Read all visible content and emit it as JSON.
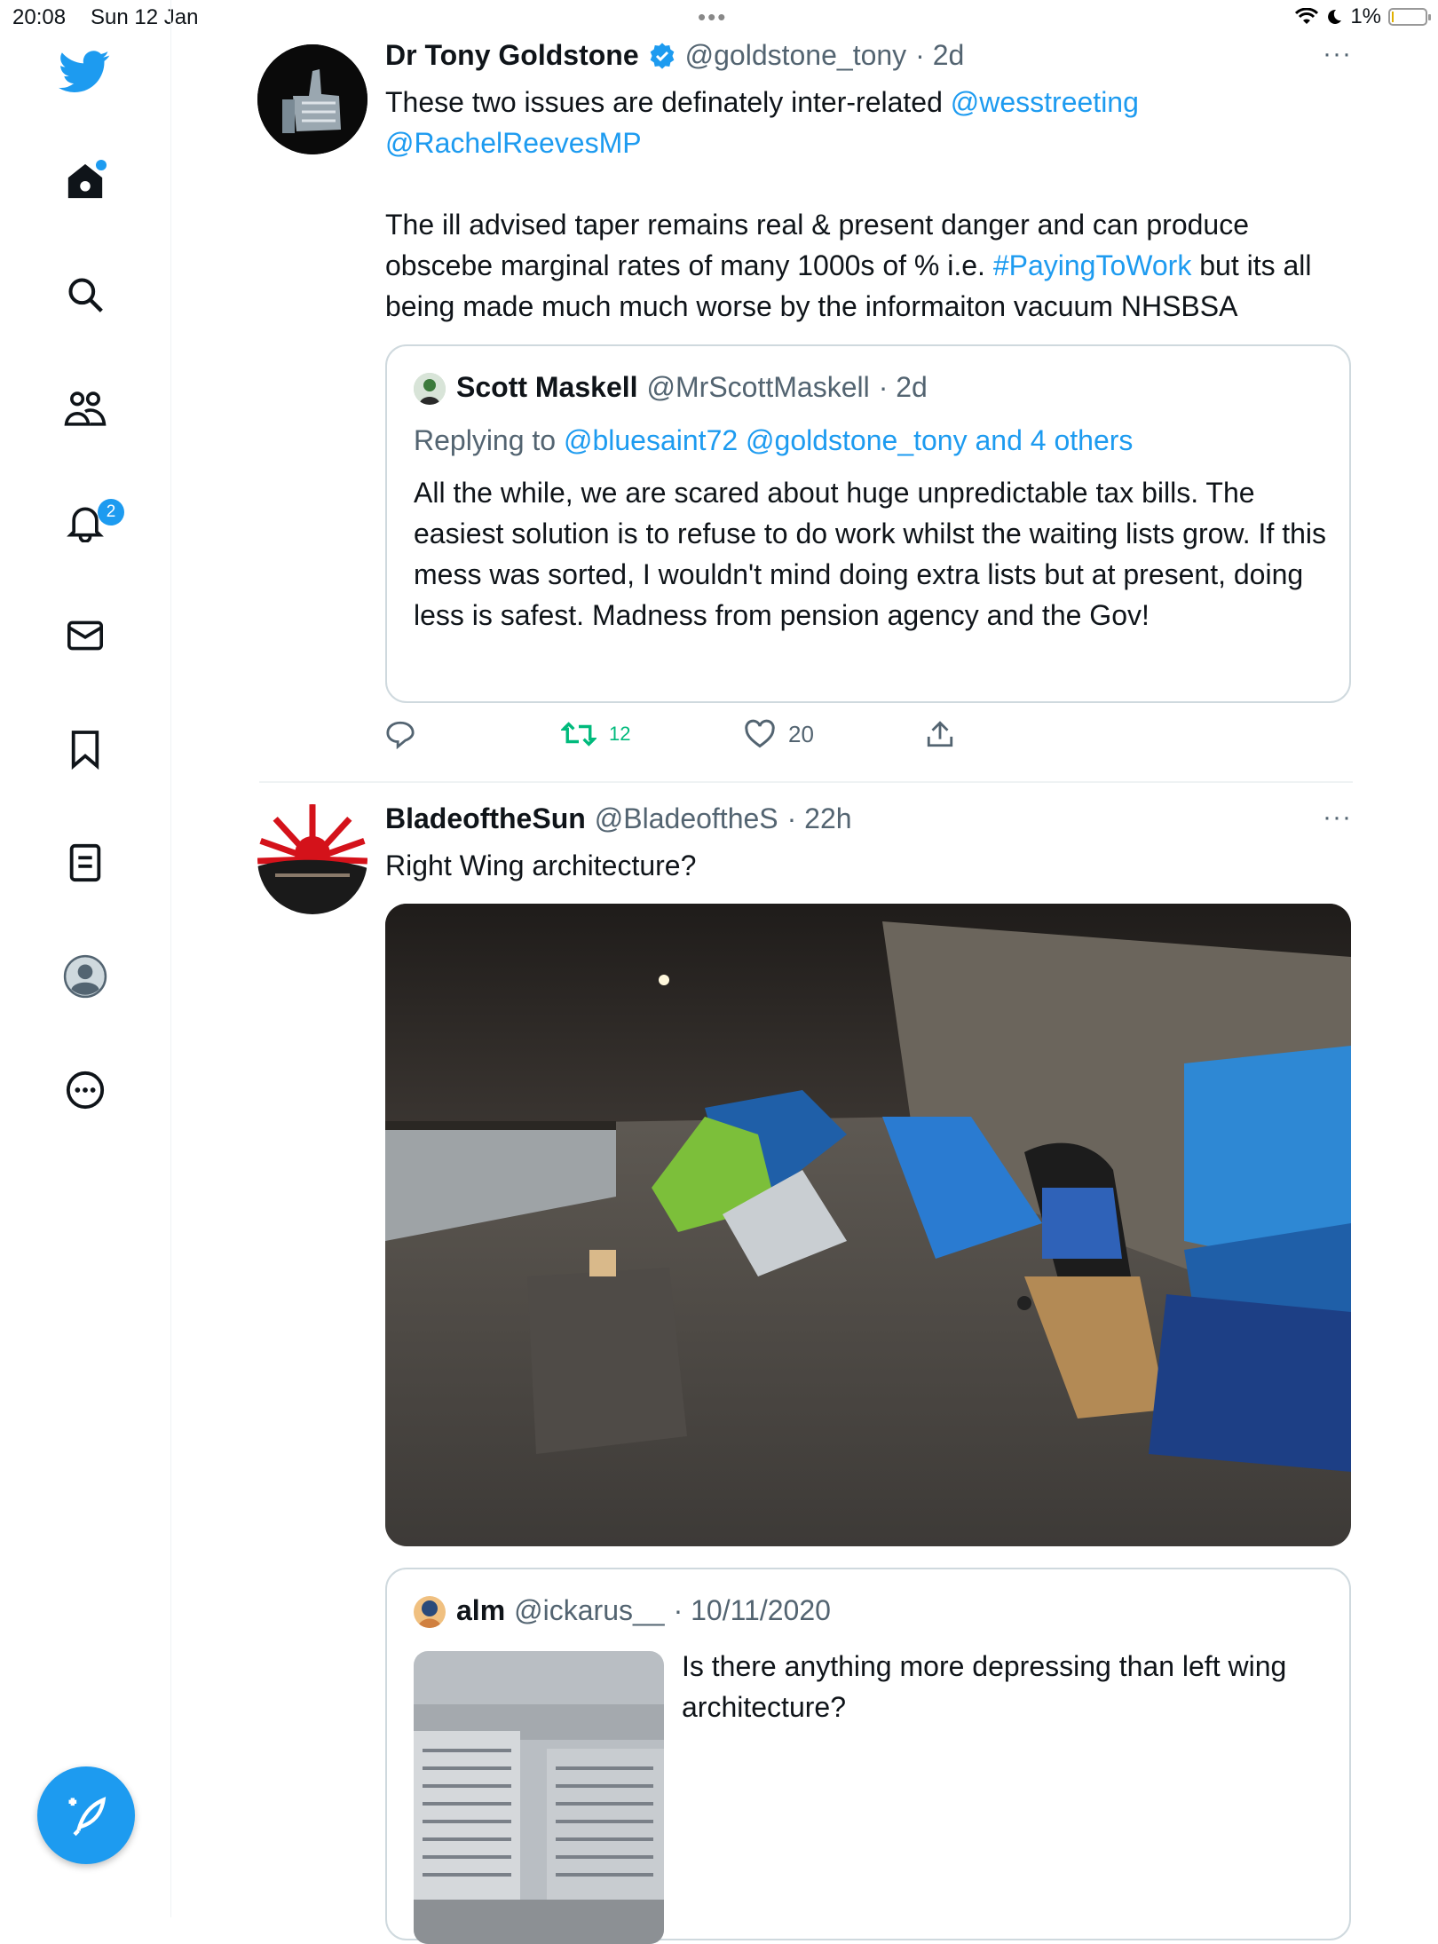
{
  "status_bar": {
    "time": "20:08",
    "date": "Sun 12 Jan",
    "battery": "1%",
    "battery_level": 0.01
  },
  "sidebar": {
    "items": [
      {
        "name": "home",
        "icon": "home-icon"
      },
      {
        "name": "explore",
        "icon": "search-icon"
      },
      {
        "name": "communities",
        "icon": "people-icon"
      },
      {
        "name": "notifications",
        "icon": "bell-icon",
        "badge": "2"
      },
      {
        "name": "messages",
        "icon": "envelope-icon"
      },
      {
        "name": "bookmarks",
        "icon": "bookmark-icon"
      },
      {
        "name": "lists",
        "icon": "list-icon"
      },
      {
        "name": "profile",
        "icon": "avatar-icon"
      },
      {
        "name": "more",
        "icon": "ellipsis-circle-icon"
      }
    ],
    "compose_icon": "feather-plus-icon"
  },
  "tweets": [
    {
      "name": "Dr Tony Goldstone",
      "verified": true,
      "handle": "@goldstone_tony",
      "time": "· 2d",
      "more": "···",
      "text_1": "These two issues are definately inter-related ",
      "mention_1": "@wesstreeting",
      "mention_2": "@RachelReevesMP",
      "text_2": "The ill advised taper remains real & present danger and can produce obscebe marginal rates of many 1000s of % i.e. ",
      "hashtag": "#PayingToWork",
      "text_3": " but its all being made much much worse by the informaiton vacuum NHSBSA",
      "quote": {
        "name": "Scott Maskell",
        "handle": "@MrScottMaskell",
        "time": "· 2d",
        "replying_prefix": "Replying to ",
        "replying_to": "@bluesaint72 @goldstone_tony and 4 others",
        "text": "All the while, we are scared about huge unpredictable tax bills. The easiest solution is to refuse to do work whilst the waiting lists grow. If this mess was sorted, I wouldn't mind doing extra lists but at present, doing less is safest. Madness from pension agency and the Gov!"
      },
      "actions": {
        "reply_count": "",
        "retweet_count": "12",
        "like_count": "20"
      },
      "colors": {
        "retweeted": "#00ba7c"
      }
    },
    {
      "name": "BladeoftheSun",
      "handle": "@BladeoftheS",
      "time": "· 22h",
      "more": "···",
      "text": "Right Wing architecture?",
      "quote": {
        "name": "alm",
        "handle": "@ickarus__",
        "time": "· 10/11/2020",
        "text": "Is there anything more depressing than left wing architecture?"
      }
    }
  ],
  "colors": {
    "accent": "#1d9bf0",
    "text": "#0f1419",
    "muted": "#536471",
    "border": "#cfd9de"
  }
}
